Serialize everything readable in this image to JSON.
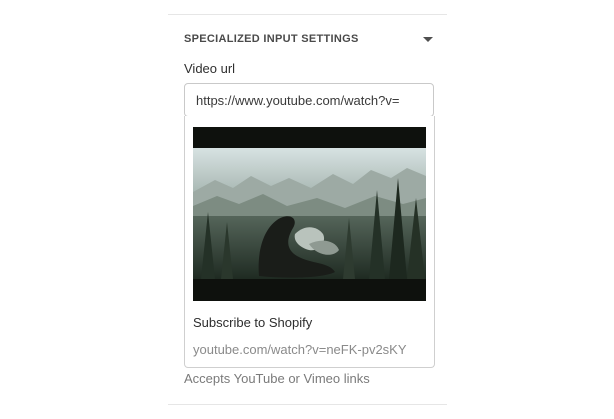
{
  "section": {
    "title": "SPECIALIZED INPUT SETTINGS",
    "toggle_icon": "caret-down-icon"
  },
  "video_url": {
    "label": "Video url",
    "value": "https://www.youtube.com/watch?v="
  },
  "preview": {
    "title": "Subscribe to Shopify",
    "link": "youtube.com/watch?v=neFK-pv2sKY"
  },
  "help_text": "Accepts YouTube or Vimeo links",
  "colors": {
    "divider": "#e6e6e6",
    "input_border": "#c9c9c9",
    "muted_text": "#8a8a8a"
  }
}
